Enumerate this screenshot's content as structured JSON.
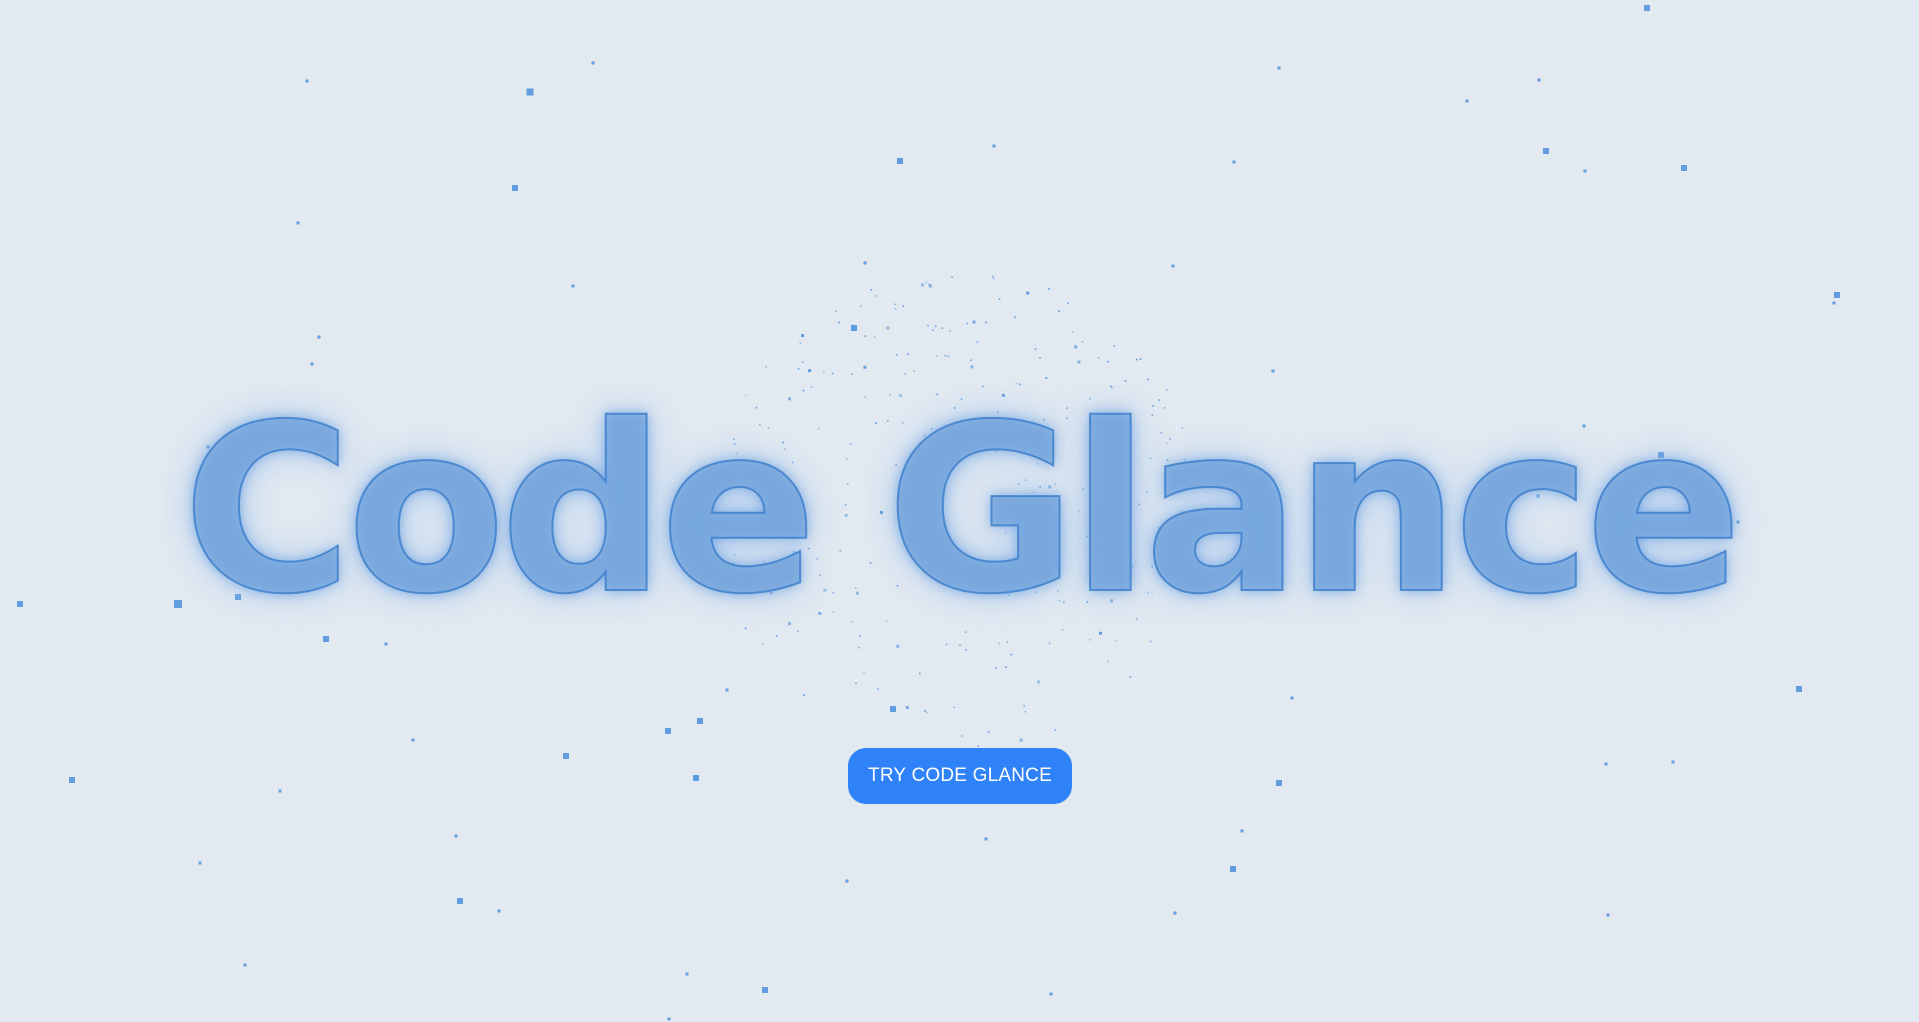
{
  "hero": {
    "title": "Code Glance"
  },
  "cta": {
    "label": "TRY CODE GLANCE"
  },
  "colors": {
    "background": "#e2e9f1",
    "particle": "#4a8fdc",
    "title_fill": "#78a8de",
    "button": "#2f82f7",
    "button_text": "#ffffff"
  }
}
